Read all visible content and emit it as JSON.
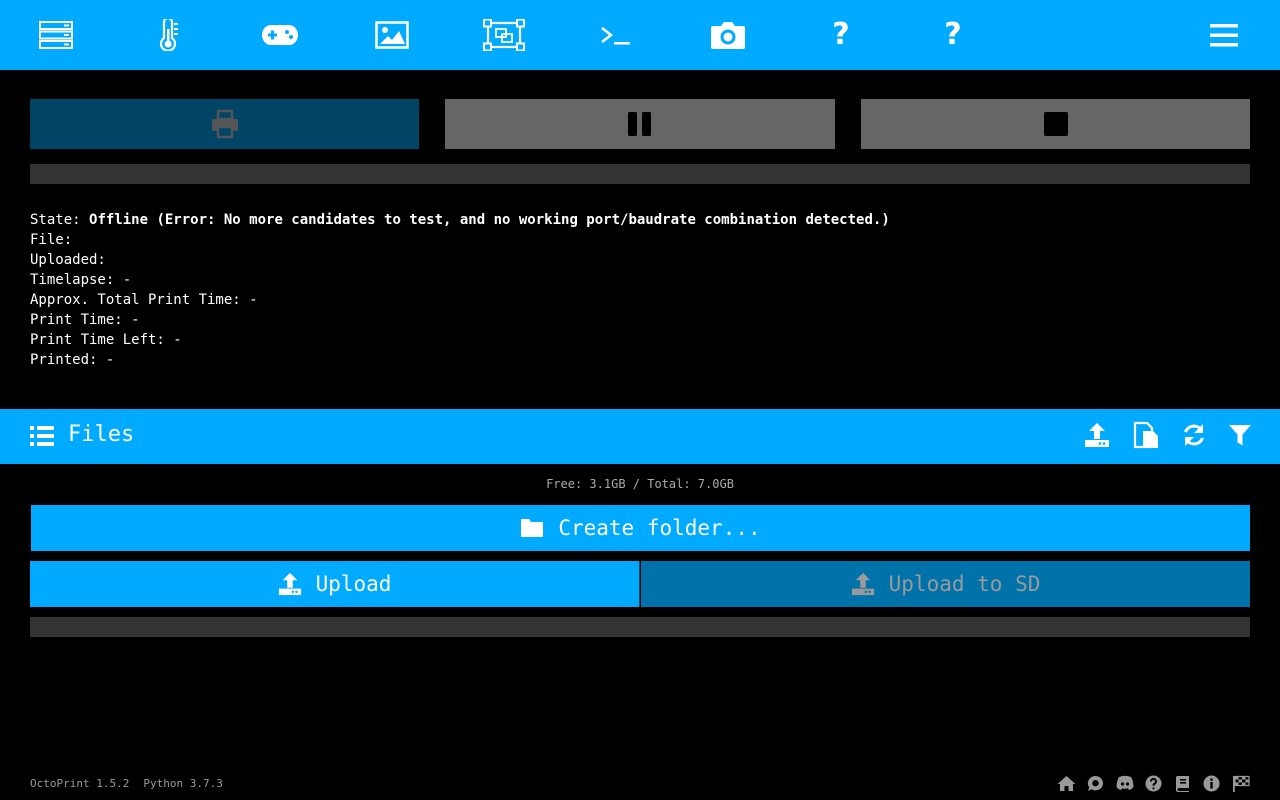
{
  "nav": {
    "items": [
      {
        "icon": "server-icon",
        "label": ""
      },
      {
        "icon": "thermometer-icon",
        "label": ""
      },
      {
        "icon": "gamepad-icon",
        "label": ""
      },
      {
        "icon": "image-icon",
        "label": ""
      },
      {
        "icon": "object-group-icon",
        "label": ""
      },
      {
        "icon": "terminal-icon",
        "label": ""
      },
      {
        "icon": "camera-icon",
        "label": ""
      },
      {
        "icon": "question-icon",
        "label": "?"
      },
      {
        "icon": "question-icon",
        "label": "?"
      },
      {
        "icon": "hamburger-menu-icon",
        "label": ""
      }
    ]
  },
  "state": {
    "state_label": "State: ",
    "state_value": "Offline (Error: No more candidates to test, and no working port/baudrate combination detected.)",
    "file": "File: ",
    "uploaded": "Uploaded: ",
    "timelapse": "Timelapse: -",
    "approx_total": "Approx. Total Print Time: -",
    "print_time": "Print Time: -",
    "print_time_left": "Print Time Left: -",
    "printed": "Printed: -"
  },
  "files": {
    "title": "Files",
    "free_info": "Free: 3.1GB / Total: 7.0GB",
    "create_folder": "Create folder...",
    "upload": "Upload",
    "upload_sd": "Upload to SD"
  },
  "footer": {
    "octoprint_version": "OctoPrint 1.5.2",
    "python_version": "Python 3.7.3"
  },
  "colors": {
    "accent": "#00aaff",
    "dark_accent": "#004466",
    "disabled": "#666666"
  }
}
